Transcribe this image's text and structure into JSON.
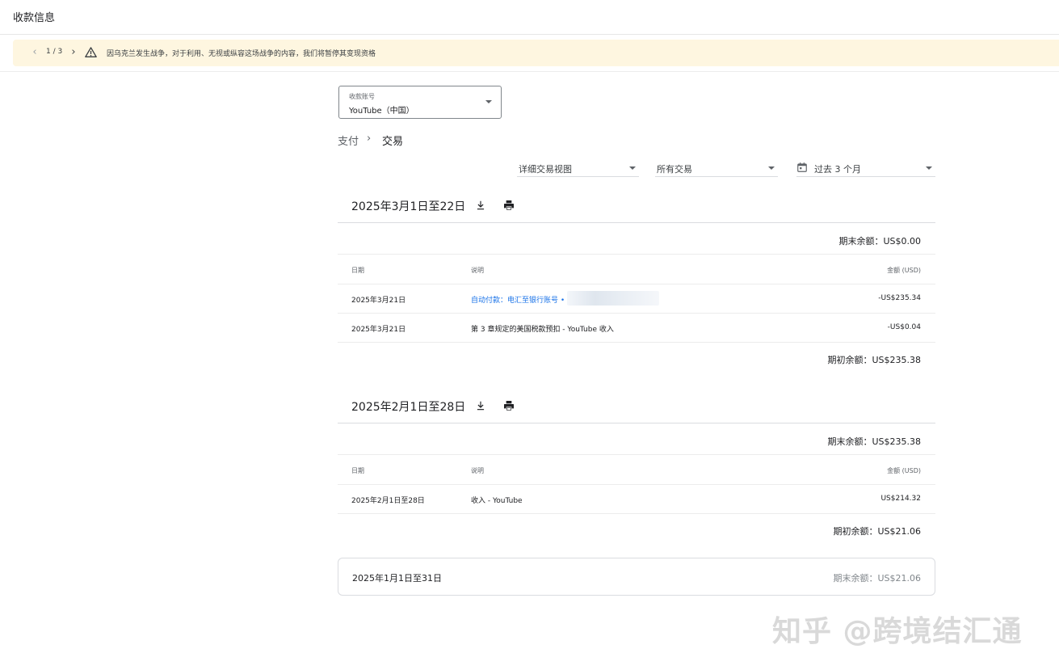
{
  "header": {
    "title": "收款信息"
  },
  "alert": {
    "counter": "1 / 3",
    "message": "因乌克兰发生战争，对于利用、无视或纵容这场战争的内容，我们将暂停其变现资格"
  },
  "account_select": {
    "label": "收款账号",
    "value": "YouTube（中国）"
  },
  "breadcrumb": {
    "parent": "支付",
    "separator": "›",
    "current": "交易"
  },
  "filters": {
    "view": "详细交易视图",
    "type": "所有交易",
    "range": "过去 3 个月"
  },
  "table_headers": {
    "date": "日期",
    "description": "说明",
    "amount": "金额 (USD)"
  },
  "sections": [
    {
      "title": "2025年3月1日至22日",
      "closing_balance": "期末余额：US$0.00",
      "rows": [
        {
          "date": "2025年3月21日",
          "description": "自动付款：电汇至银行账号 •",
          "amount": "-US$235.34"
        },
        {
          "date": "2025年3月21日",
          "description": "第 3 章规定的美国税款预扣 - YouTube 收入",
          "amount": "-US$0.04"
        }
      ],
      "opening_balance": "期初余额：US$235.38"
    },
    {
      "title": "2025年2月1日至28日",
      "closing_balance": "期末余额：US$235.38",
      "rows": [
        {
          "date": "2025年2月1日至28日",
          "description": "收入 - YouTube",
          "amount": "US$214.32"
        }
      ],
      "opening_balance": "期初余额：US$21.06"
    },
    {
      "title": "2025年1月1日至31日",
      "closing_balance": "期末余额：US$21.06"
    }
  ],
  "watermark": "知乎 @跨境结汇通",
  "colors": {
    "alert_bg": "#fef6e0",
    "link": "#1a73e8",
    "text": "#202124"
  },
  "icons": [
    "chevron-left-icon",
    "chevron-right-icon",
    "warning-icon",
    "dropdown-caret-icon",
    "calendar-icon",
    "download-icon",
    "print-icon"
  ]
}
